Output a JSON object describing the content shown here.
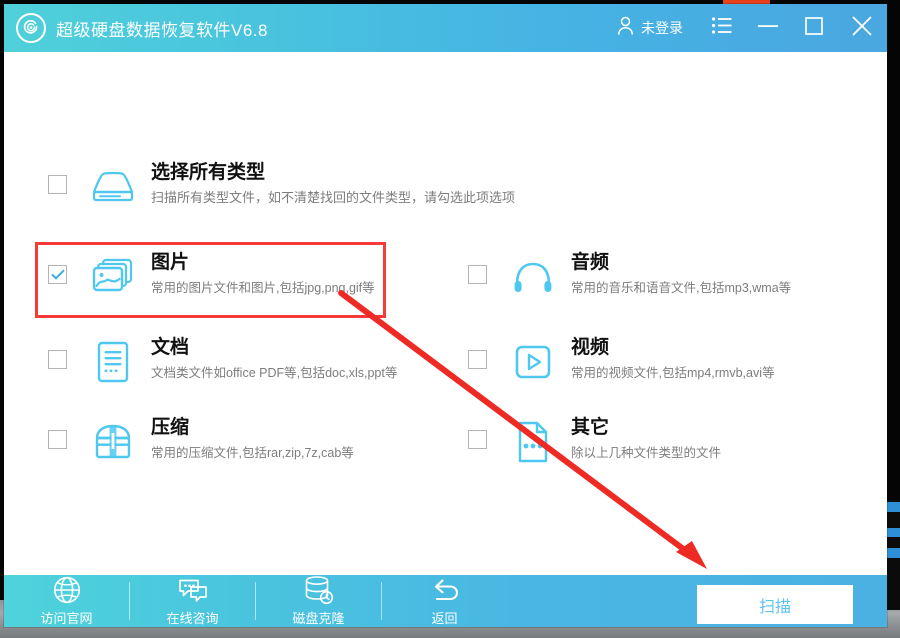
{
  "window": {
    "title": "超级硬盘数据恢复软件V6.8",
    "logo_icon": "spiral-disc-icon"
  },
  "titlebar": {
    "account_icon": "user-icon",
    "account_label": "未登录",
    "menu_icon": "list-menu-icon",
    "minimize_icon": "minimize-icon",
    "maximize_icon": "maximize-icon",
    "close_icon": "close-icon",
    "gradient_start": "#4fd0da",
    "gradient_end": "#4aa7e0"
  },
  "file_types": [
    {
      "id": "all",
      "name": "选择所有类型",
      "desc": "扫描所有类型文件，如不清楚找回的文件类型，请勾选此项选项",
      "icon": "hard-disk-icon",
      "checked": false
    },
    {
      "id": "picture",
      "name": "图片",
      "desc": "常用的图片文件和图片,包括jpg,png,gif等",
      "icon": "image-icon",
      "checked": true
    },
    {
      "id": "audio",
      "name": "音频",
      "desc": "常用的音乐和语音文件,包括mp3,wma等",
      "icon": "headphones-icon",
      "checked": false
    },
    {
      "id": "document",
      "name": "文档",
      "desc": "文档类文件如office PDF等,包括doc,xls,ppt等",
      "icon": "document-icon",
      "checked": false
    },
    {
      "id": "video",
      "name": "视频",
      "desc": "常用的视频文件,包括mp4,rmvb,avi等",
      "icon": "video-play-icon",
      "checked": false
    },
    {
      "id": "archive",
      "name": "压缩",
      "desc": "常用的压缩文件,包括rar,zip,7z,cab等",
      "icon": "archive-box-icon",
      "checked": false
    },
    {
      "id": "other",
      "name": "其它",
      "desc": "除以上几种文件类型的文件",
      "icon": "other-file-icon",
      "checked": false
    }
  ],
  "annotations": {
    "highlight_color": "#f63a38",
    "arrow_color": "#ee2a24",
    "highlight_target": "picture",
    "arrow_target": "scan-button"
  },
  "footer": {
    "items": [
      {
        "id": "website",
        "label": "访问官网",
        "icon": "globe-icon"
      },
      {
        "id": "consult",
        "label": "在线咨询",
        "icon": "chat-bubbles-icon"
      },
      {
        "id": "clone",
        "label": "磁盘克隆",
        "icon": "disk-clone-icon"
      },
      {
        "id": "back",
        "label": "返回",
        "icon": "undo-arrow-icon"
      }
    ],
    "scan_button_label": "扫描",
    "scan_button_text_color": "#5ec3ef"
  }
}
